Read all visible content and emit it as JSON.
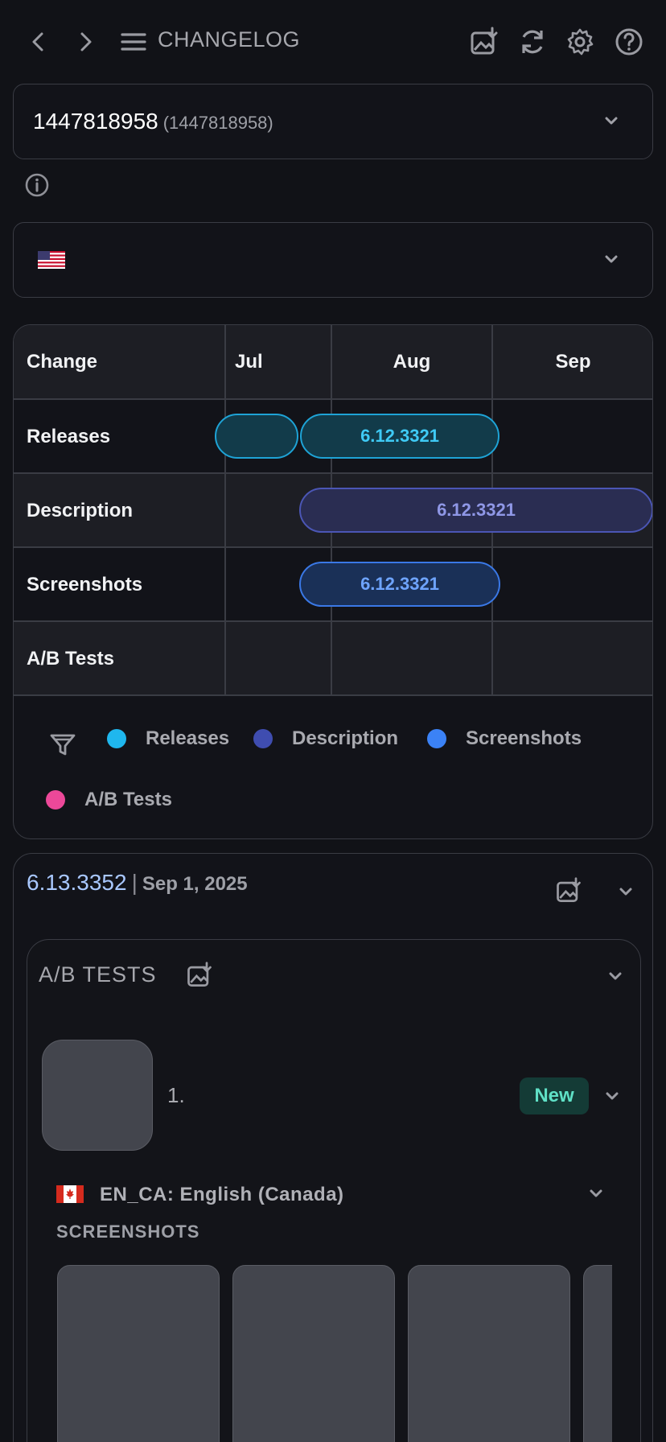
{
  "header": {
    "title": "CHANGELOG",
    "icons": [
      "back-icon",
      "forward-icon",
      "menu-icon",
      "image-download-icon",
      "refresh-icon",
      "settings-icon",
      "help-icon"
    ]
  },
  "app_select": {
    "id": "1447818958",
    "id_sub": "(1447818958)"
  },
  "country_select": {
    "flag": "us-flag-icon"
  },
  "timeline": {
    "header_label": "Change",
    "months": [
      "Jul",
      "Aug",
      "Sep"
    ],
    "rows": [
      {
        "label": "Releases"
      },
      {
        "label": "Description"
      },
      {
        "label": "Screenshots"
      },
      {
        "label": "A/B Tests"
      }
    ],
    "pills": {
      "releases_main": "6.12.3321",
      "description": "6.12.3321",
      "screenshots": "6.12.3321"
    },
    "legend": [
      {
        "label": "Releases",
        "color": "#1fb7ee"
      },
      {
        "label": "Description",
        "color": "#3f4db0"
      },
      {
        "label": "Screenshots",
        "color": "#3b82f6"
      },
      {
        "label": "A/B Tests",
        "color": "#ec4899"
      }
    ]
  },
  "version": {
    "number": "6.13.3352",
    "separator": "|",
    "date": "Sep 1, 2025"
  },
  "ab_tests": {
    "title": "A/B TESTS",
    "item_number": "1.",
    "badge": "New",
    "locale": "EN_CA: English (Canada)",
    "screenshots_label": "SCREENSHOTS"
  }
}
